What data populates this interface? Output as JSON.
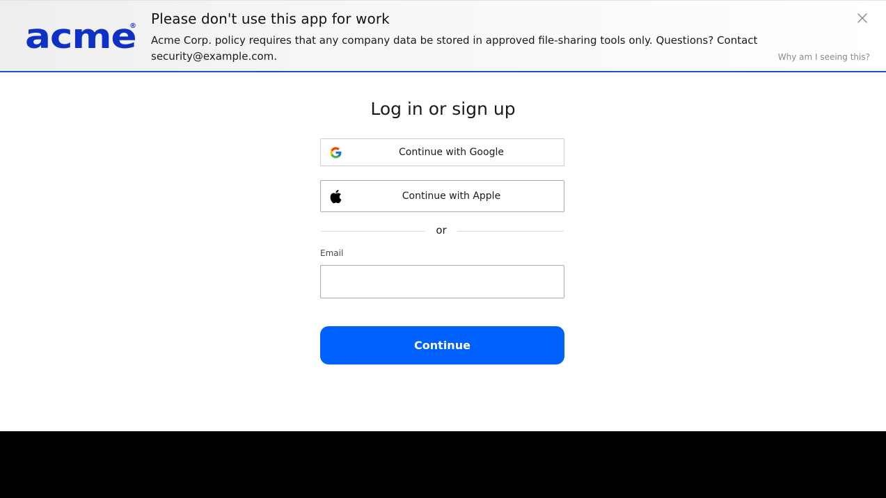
{
  "banner": {
    "logo_text": "acme",
    "logo_mark": "®",
    "title": "Please don't use this app for work",
    "body": "Acme Corp. policy requires that any company data be stored in approved file-sharing tools only. Questions? Contact security@example.com.",
    "why_link": "Why am I seeing this?",
    "close_icon": "close-icon",
    "accent_color": "#1a4fd0",
    "logo_color": "#0f30c4"
  },
  "login": {
    "title": "Log in or sign up",
    "google_label": "Continue with Google",
    "apple_label": "Continue with Apple",
    "divider_text": "or",
    "email_label": "Email",
    "email_value": "",
    "email_placeholder": "",
    "continue_label": "Continue",
    "primary_color": "#0061fe"
  }
}
